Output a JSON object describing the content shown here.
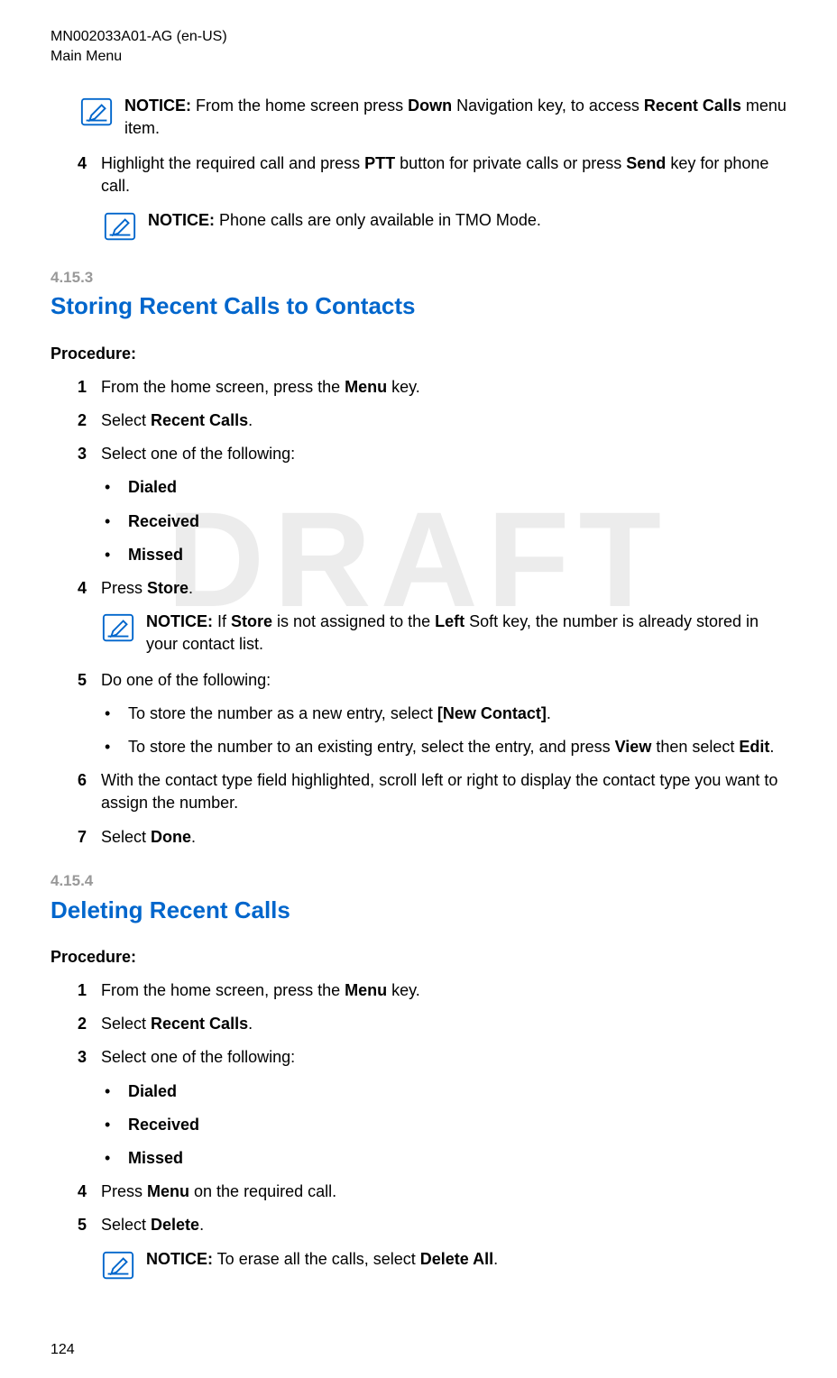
{
  "header": {
    "docId": "MN002033A01-AG (en-US)",
    "section": "Main Menu"
  },
  "watermark": "DRAFT",
  "topNotice": {
    "prefix": "NOTICE:",
    "text1": " From the home screen press ",
    "bold1": "Down",
    "text2": " Navigation key, to access ",
    "bold2": "Recent Calls",
    "text3": " menu item."
  },
  "step4": {
    "num": "4",
    "text1": "Highlight the required call and press ",
    "bold1": "PTT",
    "text2": " button for private calls or press ",
    "bold2": "Send",
    "text3": " key for phone call."
  },
  "notice2": {
    "prefix": "NOTICE:",
    "text": " Phone calls are only available in TMO Mode."
  },
  "section4153": {
    "num": "4.15.3",
    "title": "Storing Recent Calls to Contacts",
    "procedure": "Procedure:",
    "steps": {
      "s1": {
        "num": "1",
        "text1": "From the home screen, press the ",
        "bold1": "Menu",
        "text2": " key."
      },
      "s2": {
        "num": "2",
        "text1": "Select ",
        "bold1": "Recent Calls",
        "text2": "."
      },
      "s3": {
        "num": "3",
        "text": "Select one of the following:"
      },
      "bullets": {
        "b1": "Dialed",
        "b2": "Received",
        "b3": "Missed"
      },
      "s4": {
        "num": "4",
        "text1": "Press ",
        "bold1": "Store",
        "text2": "."
      },
      "notice": {
        "prefix": "NOTICE:",
        "text1": " If ",
        "bold1": "Store",
        "text2": " is not assigned to the ",
        "bold2": "Left",
        "text3": " Soft key, the number is already stored in your contact list."
      },
      "s5": {
        "num": "5",
        "text": "Do one of the following:"
      },
      "bullets5": {
        "b1_text1": "To store the number as a new entry, select ",
        "b1_bold": "[New Contact]",
        "b1_text2": ".",
        "b2_text1": "To store the number to an existing entry, select the entry, and press ",
        "b2_bold1": "View",
        "b2_text2": " then select ",
        "b2_bold2": "Edit",
        "b2_text3": "."
      },
      "s6": {
        "num": "6",
        "text": "With the contact type field highlighted, scroll left or right to display the contact type you want to assign the number."
      },
      "s7": {
        "num": "7",
        "text1": "Select ",
        "bold1": "Done",
        "text2": "."
      }
    }
  },
  "section4154": {
    "num": "4.15.4",
    "title": "Deleting Recent Calls",
    "procedure": "Procedure:",
    "steps": {
      "s1": {
        "num": "1",
        "text1": "From the home screen, press the ",
        "bold1": "Menu",
        "text2": " key."
      },
      "s2": {
        "num": "2",
        "text1": "Select ",
        "bold1": "Recent Calls",
        "text2": "."
      },
      "s3": {
        "num": "3",
        "text": "Select one of the following:"
      },
      "bullets": {
        "b1": "Dialed",
        "b2": "Received",
        "b3": "Missed"
      },
      "s4": {
        "num": "4",
        "text1": "Press ",
        "bold1": "Menu",
        "text2": " on the required call."
      },
      "s5": {
        "num": "5",
        "text1": "Select ",
        "bold1": "Delete",
        "text2": "."
      },
      "notice": {
        "prefix": "NOTICE:",
        "text1": " To erase all the calls, select ",
        "bold1": "Delete All",
        "text2": "."
      }
    }
  },
  "pageNum": "124"
}
